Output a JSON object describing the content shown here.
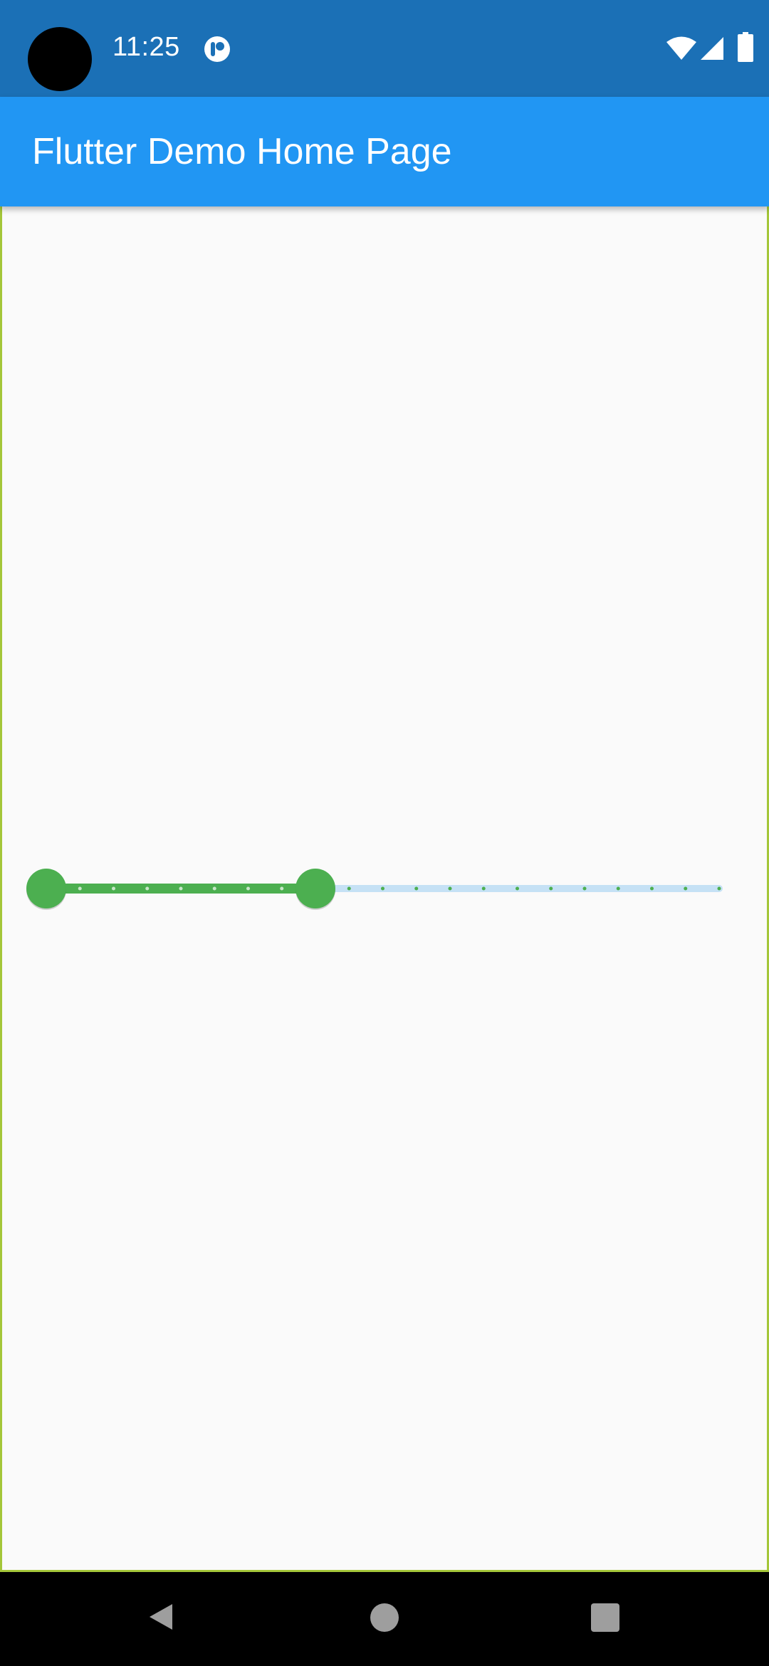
{
  "status_bar": {
    "time": "11:25",
    "background_color": "#1b70b6",
    "icons": [
      "notification-app-icon",
      "wifi-icon",
      "cellular-signal-icon",
      "battery-icon"
    ]
  },
  "app_bar": {
    "title": "Flutter Demo Home Page",
    "background_color": "#2196f3"
  },
  "range_slider": {
    "min": 0,
    "max": 20,
    "divisions": 20,
    "start_value": 0,
    "end_value": 8,
    "active_color": "#4caf50",
    "inactive_color": "#c5e1f5"
  },
  "navigation_bar": {
    "buttons": [
      "back-icon",
      "home-icon",
      "recents-icon"
    ]
  }
}
